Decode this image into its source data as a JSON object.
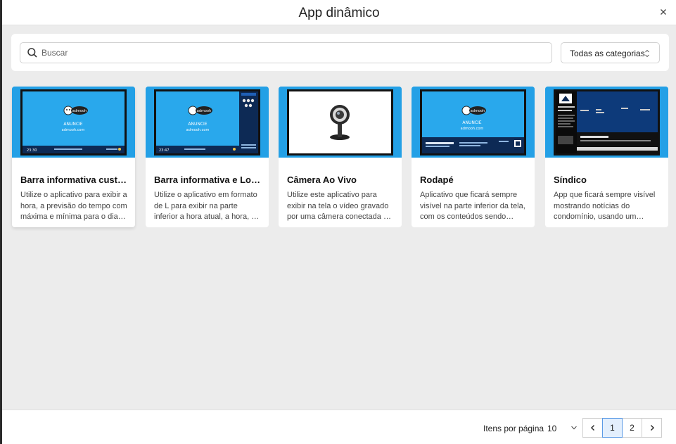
{
  "modal": {
    "title": "App dinâmico"
  },
  "search": {
    "placeholder": "Buscar",
    "value": ""
  },
  "category_filter": {
    "selected": "Todas as categorias"
  },
  "thumbnail_text": {
    "brand": "admooh",
    "cta": "ANUNCIE",
    "url": "admooh.com",
    "time_1": "23:30",
    "time_2": "23:47"
  },
  "cards": [
    {
      "title": "Barra informativa custo…",
      "description": "Utilize o aplicativo para exibir a hora, a previsão do tempo com máxima e mínima para o dia…"
    },
    {
      "title": "Barra informativa e Lote…",
      "description": "Utilize o aplicativo em formato de L para exibir na parte inferior a hora atual, a hora, a previsão…"
    },
    {
      "title": "Câmera Ao Vivo",
      "description": "Utilize este aplicativo para exibir na tela o vídeo gravado por uma câmera conectada ao seu…"
    },
    {
      "title": "Rodapé",
      "description": "Aplicativo que ficará sempre visível na parte inferior da tela, com os conteúdos sendo…"
    },
    {
      "title": "Síndico",
      "description": "App que ficará sempre visível mostrando notícias do condomínio, usando um Feed…"
    }
  ],
  "footer": {
    "items_per_page_label": "Itens por página",
    "items_per_page_value": "10",
    "pages": [
      "1",
      "2"
    ],
    "current_page": "1"
  },
  "colors": {
    "thumb_blue": "#2196e0",
    "screen_blue": "#29a8ec",
    "dark_navy": "#0d2a55",
    "active_page_bg": "#e3effd",
    "active_page_border": "#5c9be6"
  },
  "icons": {
    "close": "close-icon",
    "search": "search-icon",
    "select": "updown-chevron-icon",
    "prev": "chevron-left-icon",
    "next": "chevron-right-icon",
    "dropdown": "chevron-down-icon",
    "webcam": "webcam-icon"
  }
}
